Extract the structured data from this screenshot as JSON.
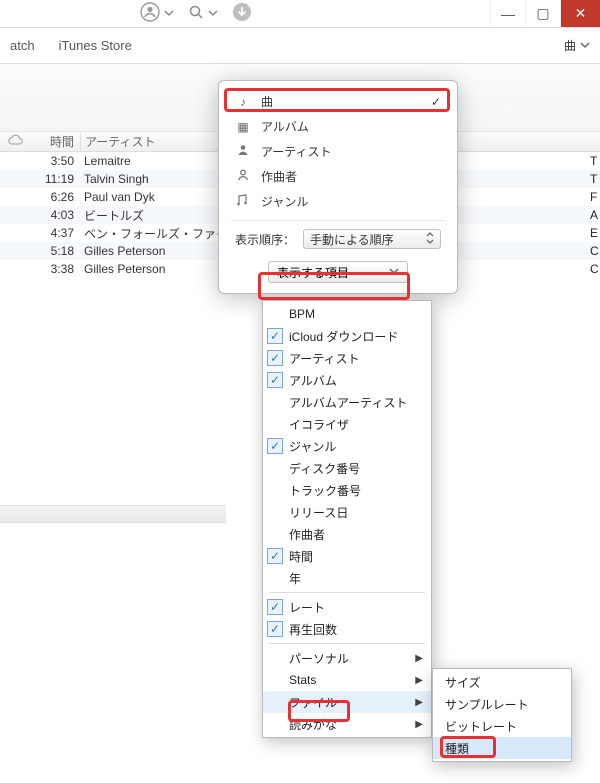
{
  "titlebar": {
    "min": "—",
    "max": "▢",
    "close": "✕"
  },
  "toolbar": {
    "tab1": "atch",
    "tab2": "iTunes Store",
    "viewLabel": "曲"
  },
  "columns": {
    "time": "時間",
    "artist": "アーティスト"
  },
  "tracks": [
    {
      "time": "3:50",
      "artist": "Lemaitre",
      "extra": "T"
    },
    {
      "time": "11:19",
      "artist": "Talvin Singh",
      "extra": "T"
    },
    {
      "time": "6:26",
      "artist": "Paul van Dyk",
      "extra": "F"
    },
    {
      "time": "4:03",
      "artist": "ビートルズ",
      "extra": "A"
    },
    {
      "time": "4:37",
      "artist": "ベン・フォールズ・ファイブ",
      "extra": "E"
    },
    {
      "time": "5:18",
      "artist": "Gilles Peterson",
      "extra": "C"
    },
    {
      "time": "3:38",
      "artist": "Gilles Peterson",
      "extra": "C"
    }
  ],
  "pop1": {
    "songs": "曲",
    "albums": "アルバム",
    "artists": "アーティスト",
    "composers": "作曲者",
    "genres": "ジャンル",
    "sortLabel": "表示順序：",
    "sortValue": "手動による順序",
    "fieldsBtn": "表示する項目"
  },
  "fields": {
    "bpm": "BPM",
    "icloud": "iCloud ダウンロード",
    "artist": "アーティスト",
    "album": "アルバム",
    "albumArtist": "アルバムアーティスト",
    "equalizer": "イコライザ",
    "genre": "ジャンル",
    "discNo": "ディスク番号",
    "trackNo": "トラック番号",
    "release": "リリース日",
    "composer": "作曲者",
    "time": "時間",
    "year": "年",
    "rate": "レート",
    "plays": "再生回数",
    "personal": "パーソナル",
    "stats": "Stats",
    "file": "ファイル",
    "sortReadings": "読みがな"
  },
  "fileSub": {
    "size": "サイズ",
    "sampleRate": "サンプルレート",
    "bitrate": "ビットレート",
    "kind": "種類"
  }
}
